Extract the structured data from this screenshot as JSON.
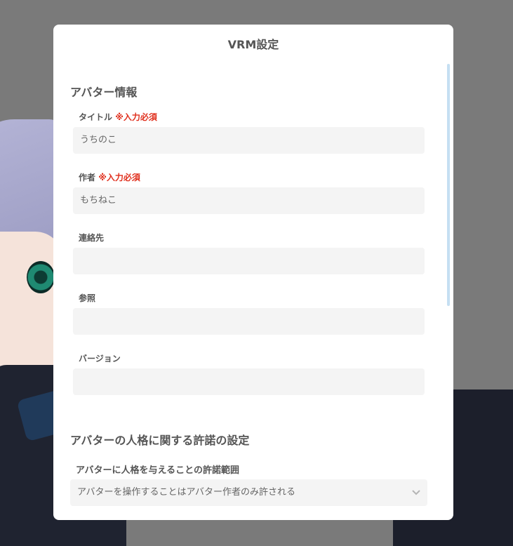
{
  "dialog": {
    "title": "VRM設定"
  },
  "avatar_info": {
    "heading": "アバター情報",
    "fields": [
      {
        "label": "タイトル",
        "required": "※入力必須",
        "value": "うちのこ"
      },
      {
        "label": "作者",
        "required": "※入力必須",
        "value": "もちねこ"
      },
      {
        "label": "連絡先",
        "value": ""
      },
      {
        "label": "参照",
        "value": ""
      },
      {
        "label": "バージョン",
        "value": ""
      }
    ]
  },
  "permissions": {
    "heading": "アバターの人格に関する許諾の設定",
    "persona_scope": {
      "label": "アバターに人格を与えることの許諾範囲",
      "selected": "アバターを操作することはアバター作者のみ許される"
    }
  },
  "icons": {
    "dropdown": "chevron-down-icon"
  },
  "colors": {
    "required": "#e0301e",
    "scrollbar": "#c5dff2"
  }
}
